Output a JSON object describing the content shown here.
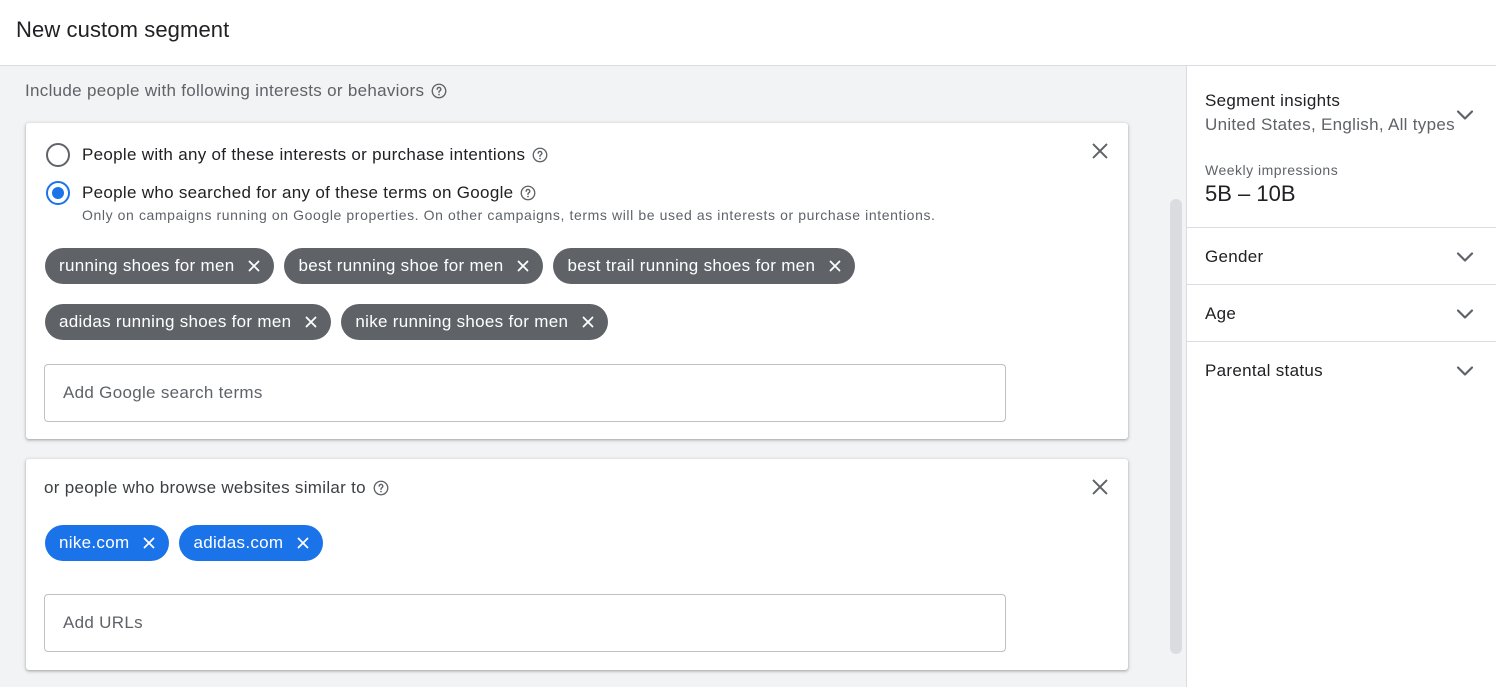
{
  "header": {
    "title": "New custom segment"
  },
  "main": {
    "section_label": "Include people with following interests or behaviors",
    "card1": {
      "radio_options": [
        {
          "label": "People with any of these interests or purchase intentions",
          "checked": false
        },
        {
          "label": "People who searched for any of these terms on Google",
          "checked": true
        }
      ],
      "note": "Only on campaigns running on Google properties. On other campaigns, terms will be used as interests or purchase intentions.",
      "chips": [
        "running shoes for men",
        "best running shoe for men",
        "best trail running shoes for men",
        "adidas running shoes for men",
        "nike running shoes for men"
      ],
      "input_placeholder": "Add Google search terms"
    },
    "card2": {
      "title": "or people who browse websites similar to",
      "chips": [
        "nike.com",
        "adidas.com"
      ],
      "input_placeholder": "Add URLs"
    }
  },
  "sidebar": {
    "insights": {
      "title": "Segment insights",
      "subtitle": "United States, English, All types",
      "impressions_label": "Weekly impressions",
      "impressions_value": "5B – 10B"
    },
    "accordions": [
      "Gender",
      "Age",
      "Parental status"
    ]
  },
  "colors": {
    "accent": "#1a73e8",
    "chip_dark": "#5f6368",
    "background": "#f1f3f4"
  },
  "icons": {
    "help": "help-circle-icon",
    "close": "close-icon",
    "chip_remove": "close-icon",
    "expand": "chevron-down-icon"
  }
}
